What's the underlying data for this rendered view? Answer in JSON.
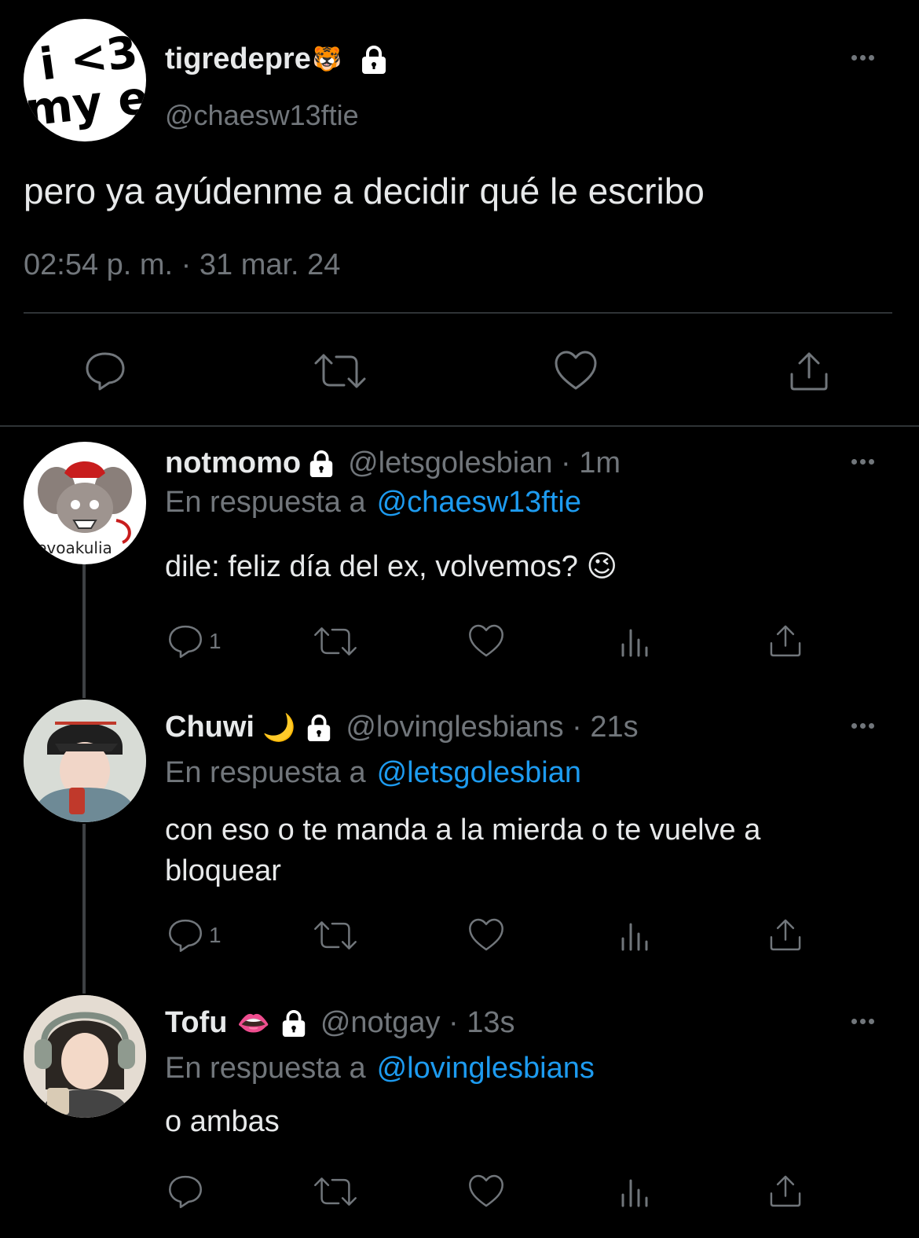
{
  "main": {
    "display_name": "tigredepre",
    "name_emoji": "🐯",
    "handle": "@chaesw13ftie",
    "avatar_text_top": "i <3",
    "avatar_text_bottom": "my ex",
    "text": "pero ya ayúdenme a decidir qué le escribo",
    "timestamp": "02:54 p. m. · 31 mar. 24"
  },
  "reply_prefix": "En respuesta a",
  "replies": [
    {
      "display_name": "notmomo",
      "name_emoji": "",
      "handle_time": "@letsgolesbian · 1m",
      "reply_to": "@chaesw13ftie",
      "text": "dile: feliz día del ex, volvemos? 😉",
      "reply_count": "1",
      "avatar_caption": "llevoakulia"
    },
    {
      "display_name": "Chuwi",
      "name_emoji": "🌙",
      "handle_time": "@lovinglesbians · 21s",
      "reply_to": "@letsgolesbian",
      "text": "con eso o te manda a la mierda o te vuelve a bloquear",
      "reply_count": "1"
    },
    {
      "display_name": "Tofu",
      "name_emoji": "👄",
      "handle_time": "@notgay · 13s",
      "reply_to": "@lovinglesbians",
      "text": "o ambas",
      "reply_count": ""
    }
  ],
  "icons": [
    "reply-icon",
    "retweet-icon",
    "like-icon",
    "views-icon",
    "share-icon",
    "lock-icon",
    "more-icon"
  ],
  "colors": {
    "background": "#000000",
    "text": "#e7e9ea",
    "secondary": "#71767b",
    "link": "#1d9bf0",
    "divider": "#2f3336"
  }
}
